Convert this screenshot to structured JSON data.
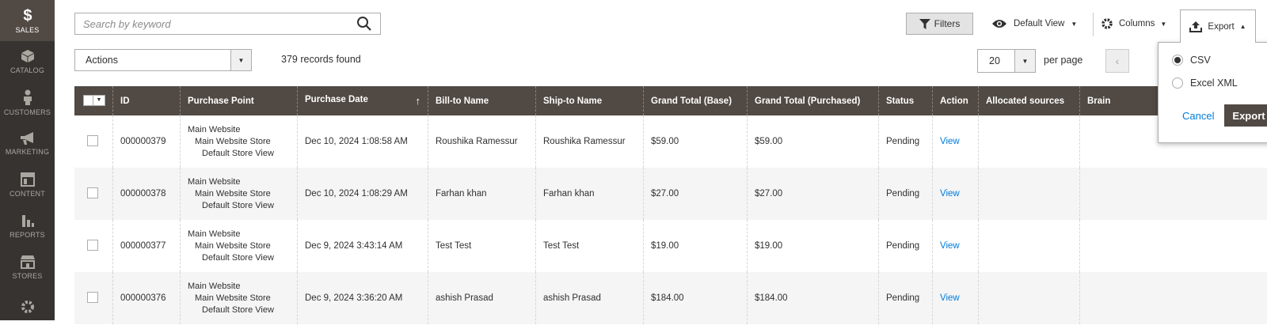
{
  "sidebar": {
    "items": [
      {
        "label": "SALES",
        "icon": "dollar-icon"
      },
      {
        "label": "CATALOG",
        "icon": "box-icon"
      },
      {
        "label": "CUSTOMERS",
        "icon": "person-icon"
      },
      {
        "label": "MARKETING",
        "icon": "megaphone-icon"
      },
      {
        "label": "CONTENT",
        "icon": "layout-icon"
      },
      {
        "label": "REPORTS",
        "icon": "bar-chart-icon"
      },
      {
        "label": "STORES",
        "icon": "store-icon"
      },
      {
        "label": "",
        "icon": "gear-icon"
      }
    ]
  },
  "search": {
    "placeholder": "Search by keyword"
  },
  "toolbar": {
    "filters": "Filters",
    "view": "Default View",
    "columns": "Columns",
    "export": "Export"
  },
  "actions": {
    "label": "Actions",
    "records": "379 records found"
  },
  "pager": {
    "per_page_value": "20",
    "per_page_label": "per page"
  },
  "table": {
    "columns": [
      "ID",
      "Purchase Point",
      "Purchase Date",
      "Bill-to Name",
      "Ship-to Name",
      "Grand Total (Base)",
      "Grand Total (Purchased)",
      "Status",
      "Action",
      "Allocated sources",
      "Brain"
    ],
    "rows": [
      {
        "id": "000000379",
        "pp1": "Main Website",
        "pp2": "Main Website Store",
        "pp3": "Default Store View",
        "date": "Dec 10, 2024 1:08:58 AM",
        "bill": "Roushika Ramessur",
        "ship": "Roushika Ramessur",
        "base": "$59.00",
        "purchased": "$59.00",
        "status": "Pending",
        "action": "View"
      },
      {
        "id": "000000378",
        "pp1": "Main Website",
        "pp2": "Main Website Store",
        "pp3": "Default Store View",
        "date": "Dec 10, 2024 1:08:29 AM",
        "bill": "Farhan khan",
        "ship": "Farhan khan",
        "base": "$27.00",
        "purchased": "$27.00",
        "status": "Pending",
        "action": "View"
      },
      {
        "id": "000000377",
        "pp1": "Main Website",
        "pp2": "Main Website Store",
        "pp3": "Default Store View",
        "date": "Dec 9, 2024 3:43:14 AM",
        "bill": "Test Test",
        "ship": "Test Test",
        "base": "$19.00",
        "purchased": "$19.00",
        "status": "Pending",
        "action": "View"
      },
      {
        "id": "000000376",
        "pp1": "Main Website",
        "pp2": "Main Website Store",
        "pp3": "Default Store View",
        "date": "Dec 9, 2024 3:36:20 AM",
        "bill": "ashish Prasad",
        "ship": "ashish Prasad",
        "base": "$184.00",
        "purchased": "$184.00",
        "status": "Pending",
        "action": "View"
      }
    ]
  },
  "export_menu": {
    "options": [
      "CSV",
      "Excel XML"
    ],
    "selected": "CSV",
    "cancel": "Cancel",
    "submit": "Export"
  }
}
